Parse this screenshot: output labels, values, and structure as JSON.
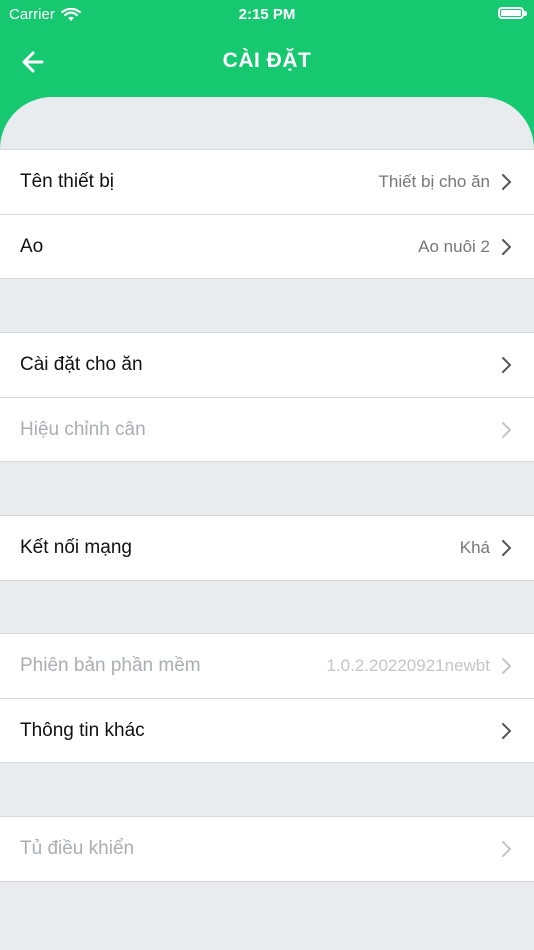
{
  "status": {
    "carrier": "Carrier",
    "time": "2:15 PM"
  },
  "header": {
    "title": "CÀI ĐẶT",
    "back_icon": "arrow-left-icon"
  },
  "groups": [
    {
      "rows": [
        {
          "label": "Tên thiết bị",
          "value": "Thiết bị cho ăn"
        },
        {
          "label": "Ao",
          "value": "Ao nuôi 2"
        }
      ]
    },
    {
      "rows": [
        {
          "label": "Cài đặt cho ăn",
          "value": ""
        },
        {
          "label": "Hiệu chỉnh cân",
          "value": "",
          "disabled": true
        }
      ]
    },
    {
      "rows": [
        {
          "label": "Kết nối mạng",
          "value": "Khá"
        }
      ]
    },
    {
      "rows": [
        {
          "label": "Phiên bản phần mềm",
          "value": "1.0.2.20220921newbt",
          "disabled": true
        },
        {
          "label": "Thông tin khác",
          "value": ""
        }
      ]
    },
    {
      "rows": [
        {
          "label": "Tủ điều khiển",
          "value": "",
          "disabled": true
        }
      ]
    }
  ],
  "colors": {
    "header_green": "#16c971",
    "background": "#e9ecef"
  }
}
